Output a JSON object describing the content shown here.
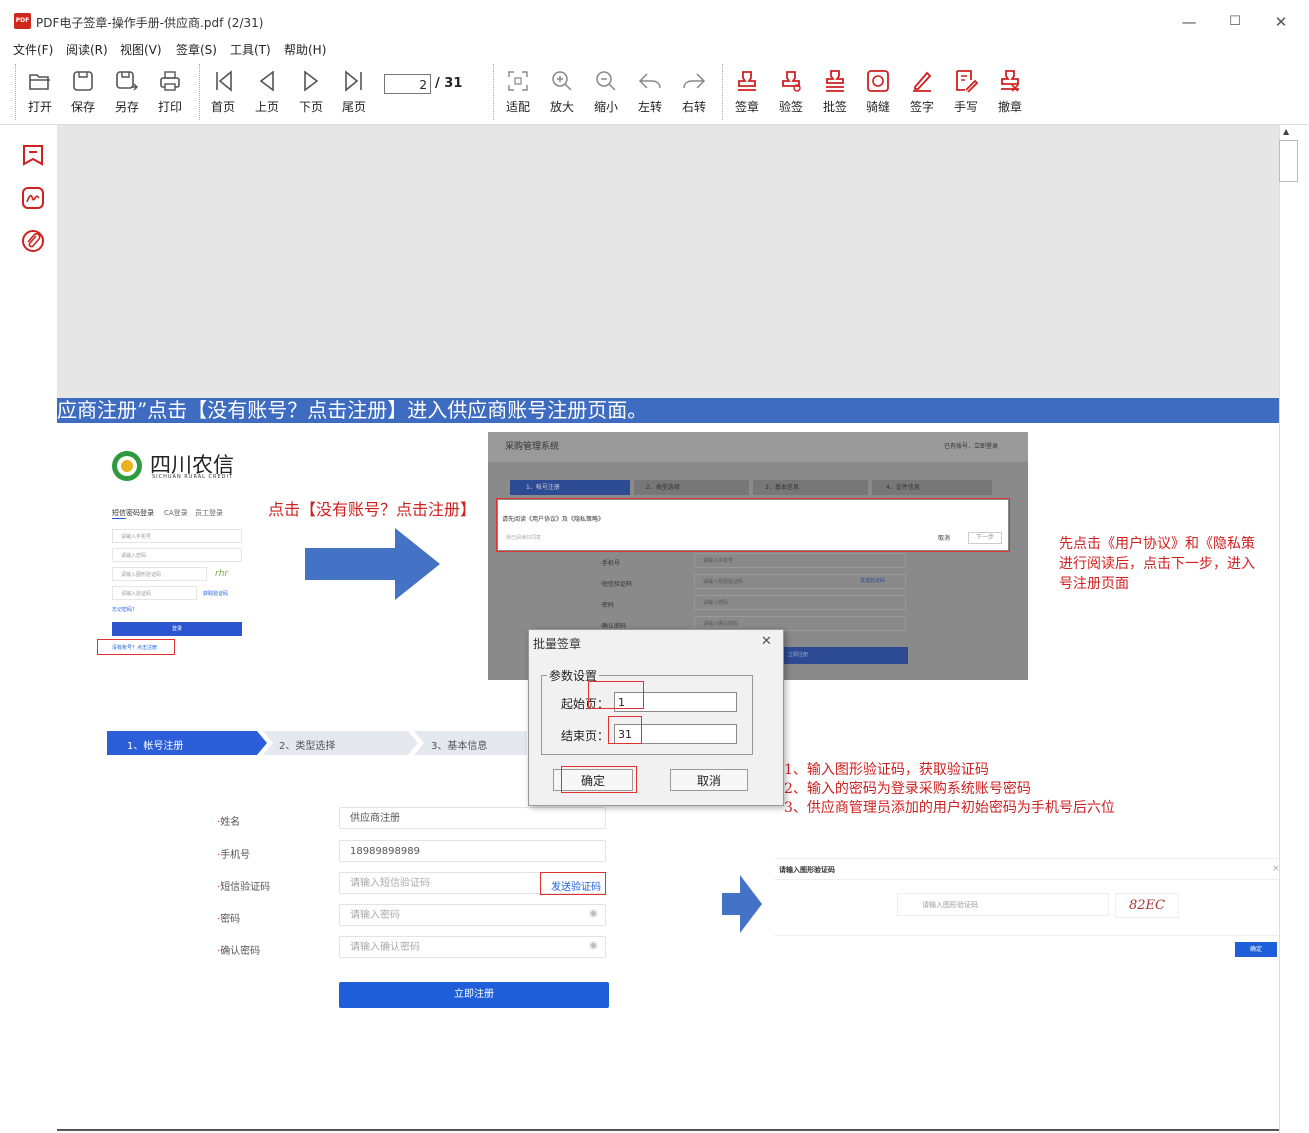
{
  "window": {
    "title": "PDF电子签章-操作手册-供应商.pdf (2/31)",
    "app_icon_text": "PDF",
    "min": "—",
    "max": "☐",
    "close": "✕"
  },
  "menu": [
    "文件(F)",
    "阅读(R)",
    "视图(V)",
    "签章(S)",
    "工具(T)",
    "帮助(H)"
  ],
  "toolbar": {
    "open": "打开",
    "save": "保存",
    "save_as": "另存",
    "print": "打印",
    "first": "首页",
    "prev": "上页",
    "next": "下页",
    "last": "尾页",
    "page_current": "2",
    "page_total": "/ 31",
    "fit": "适配",
    "zoom_in": "放大",
    "zoom_out": "缩小",
    "rotate_left": "左转",
    "rotate_right": "右转",
    "sign": "签章",
    "verify": "验签",
    "batch": "批签",
    "seam": "骑缝",
    "signature": "签字",
    "handwrite": "手写",
    "revoke": "撤章"
  },
  "doc": {
    "banner": "供应商注册”点击【没有账号？点击注册】进入供应商账号注册页面。",
    "logo_cn": "四川农信",
    "logo_en": "SICHUAN RURAL CREDIT",
    "login_tabs": [
      "短信密码登录",
      "CA登录",
      "员工登录"
    ],
    "login_fields": [
      "请输入手机号",
      "请输入密码",
      "请输入图形验证码",
      "请输入验证码"
    ],
    "captcha_small": "rhr",
    "get_code_small": "获取验证码",
    "forgot": "忘记密码?",
    "login_btn": "登录",
    "no_account": "没有账号？点击注册",
    "click_note": "点击【没有账号？点击注册】",
    "shot_title": "采购管理系统",
    "shot_right": "已有账号，立即登录",
    "shot_steps": [
      "1、帐号注册",
      "2、类型选择",
      "3、基本信息",
      "4、证件信息"
    ],
    "agree_text": "请先阅读《用户协议》及《隐私策略》",
    "agree_check": "我已阅读并同意",
    "agree_cancel": "取消",
    "agree_next": "下一步",
    "shot_labels": [
      "·手机号",
      "·短信验证码",
      "·密码",
      "·确认密码"
    ],
    "shot_fields": [
      "请输入手机号",
      "请输入短信验证码",
      "请输入密码",
      "请输入确认密码"
    ],
    "shot_send": "发送验证码",
    "shot_submit": "立即注册",
    "right_note_1": "先点击《用户协议》和《隐私策",
    "right_note_2": "进行阅读后，点击下一步，进入",
    "right_note_3": "号注册页面",
    "steps2": [
      "1、帐号注册",
      "2、类型选择",
      "3、基本信息"
    ],
    "form_labels": [
      "姓名",
      "手机号",
      "短信验证码",
      "密码",
      "确认密码"
    ],
    "form_values": [
      "供应商注册",
      "18989898989",
      "请输入短信验证码",
      "请输入密码",
      "请输入确认密码"
    ],
    "send_code": "发送验证码",
    "register_btn": "立即注册",
    "notes": [
      "1、输入图形验证码，获取验证码",
      "2、输入的密码为登录采购系统账号密码",
      "3、供应商管理员添加的用户初始密码为手机号后六位"
    ],
    "captcha_title": "请输入图形验证码",
    "captcha_placeholder": "请输入图形验证码",
    "captcha_img": "82EC",
    "captcha_ok": "确定",
    "captcha_close": "×"
  },
  "dialog": {
    "title": "批量签章",
    "close": "✕",
    "group": "参数设置",
    "start_label": "起始页：",
    "start_value": "1",
    "end_label": "结束页：",
    "end_value": "31",
    "ok": "确定",
    "cancel": "取消"
  },
  "colors": {
    "accent_red": "#d02020",
    "banner_blue": "#3d6cc1",
    "button_blue": "#1e5fd9"
  }
}
